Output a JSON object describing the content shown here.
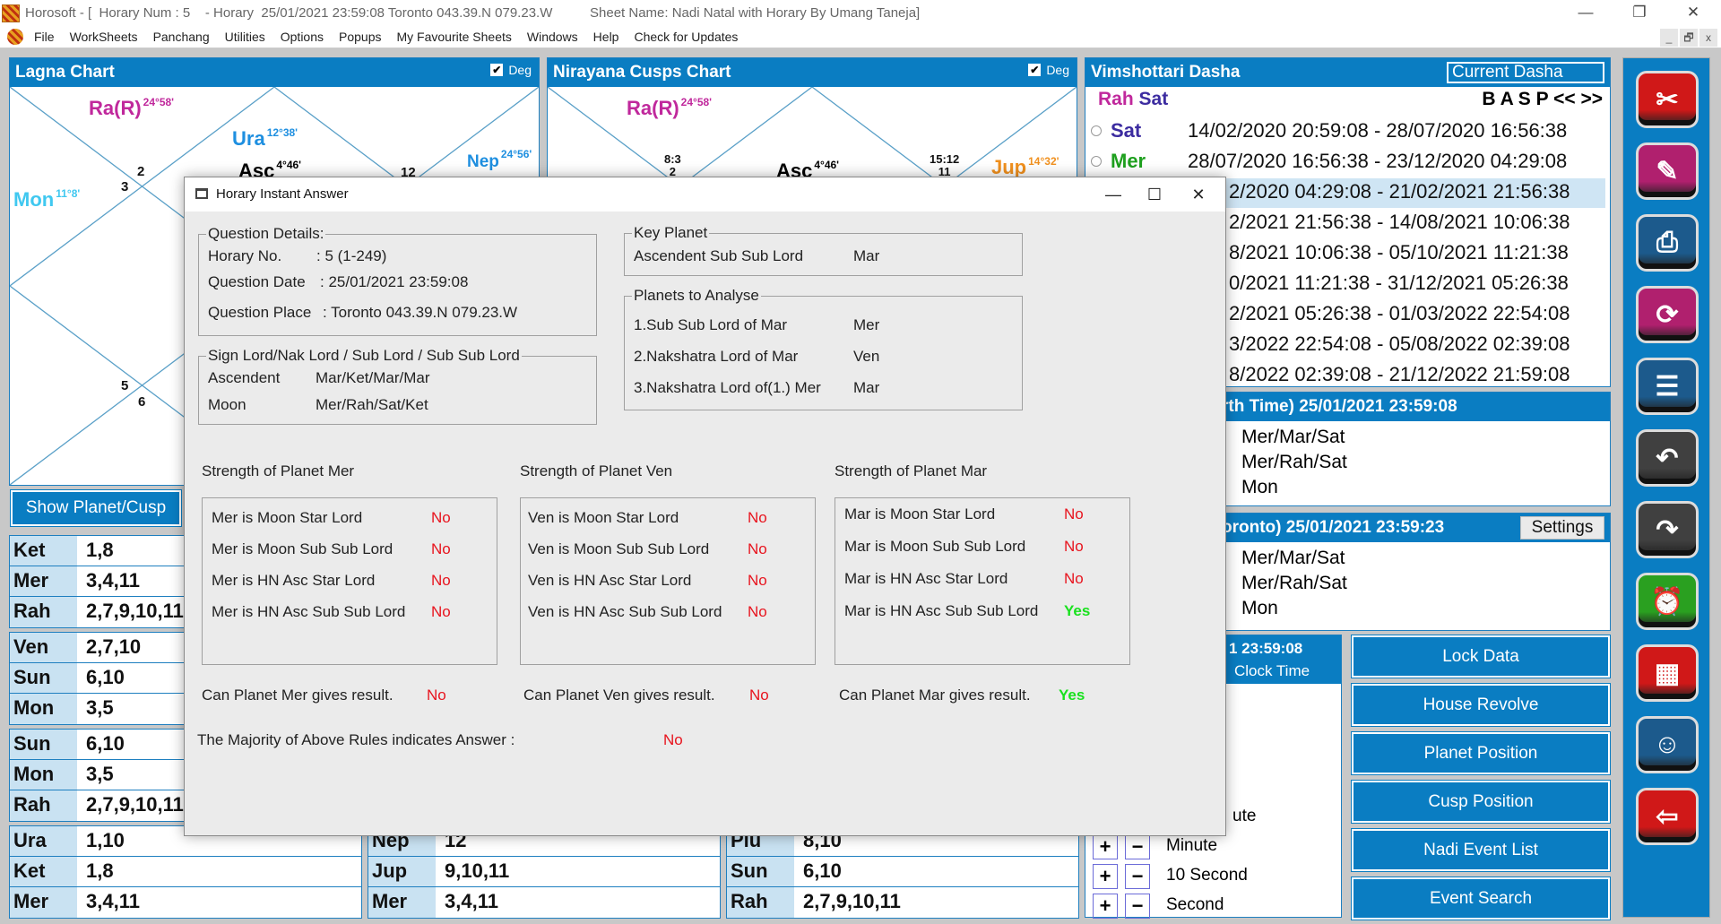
{
  "window": {
    "title": "Horosoft - [  Horary Num : 5    - Horary  25/01/2021 23:59:08 Toronto 043.39.N 079.23.W",
    "sheet_name": "Sheet Name: Nadi Natal with Horary By Umang Taneja]",
    "controls": {
      "minimize": "—",
      "restore": "❐",
      "close": "✕"
    }
  },
  "menubar": {
    "items": [
      "File",
      "WorkSheets",
      "Panchang",
      "Utilities",
      "Options",
      "Popups",
      "My Favourite Sheets",
      "Windows",
      "Help",
      "Check for Updates"
    ],
    "mdi_controls": [
      "_",
      "🗗",
      "x"
    ]
  },
  "lagna_chart": {
    "title": "Lagna Chart",
    "deg_label": "Deg",
    "deg_checked": true,
    "planets": [
      {
        "name": "Ra(R)",
        "deg": "24°58'",
        "color": "#c0289c"
      },
      {
        "name": "Ura",
        "deg": "12°38'",
        "color": "#1e8fe0"
      },
      {
        "name": "Asc",
        "deg": "4°46'",
        "color": "#111111"
      },
      {
        "name": "Nep",
        "deg": "24°56'",
        "color": "#1e8fe0"
      },
      {
        "name": "Mon",
        "deg": "11°8'",
        "color": "#40c8f0"
      }
    ],
    "house_numbers": [
      "2",
      "3",
      "12",
      "5",
      "6"
    ]
  },
  "cusps_chart": {
    "title": "Nirayana Cusps Chart",
    "deg_label": "Deg",
    "deg_checked": true,
    "planets": [
      {
        "name": "Ra(R)",
        "deg": "24°58'",
        "color": "#c0289c"
      },
      {
        "name": "Asc",
        "deg": "4°46'",
        "color": "#111111"
      },
      {
        "name": "Jup",
        "deg": "14°32'",
        "color": "#f0901e"
      }
    ],
    "cusp_labels": [
      {
        "deg": "8:3",
        "house": "2"
      },
      {
        "deg": "15:12",
        "house": "11"
      }
    ]
  },
  "show_planet_button": "Show Planet/Cusp",
  "left_tables": [
    [
      [
        "Ket",
        "1,8"
      ],
      [
        "Mer",
        "3,4,11"
      ],
      [
        "Rah",
        "2,7,9,10,11"
      ]
    ],
    [
      [
        "Ven",
        "2,7,10"
      ],
      [
        "Sun",
        "6,10"
      ],
      [
        "Mon",
        "3,5"
      ]
    ],
    [
      [
        "Sun",
        "6,10"
      ],
      [
        "Mon",
        "3,5"
      ],
      [
        "Rah",
        "2,7,9,10,11"
      ]
    ],
    [
      [
        "Ura",
        "1,10"
      ],
      [
        "Ket",
        "1,8"
      ],
      [
        "Mer",
        "3,4,11"
      ]
    ]
  ],
  "bottom_tables": [
    [
      [
        "Nep",
        "12"
      ],
      [
        "Jup",
        "9,10,11"
      ],
      [
        "Mer",
        "3,4,11"
      ]
    ],
    [
      [
        "Plu",
        "8,10"
      ],
      [
        "Sun",
        "6,10"
      ],
      [
        "Rah",
        "2,7,9,10,11"
      ]
    ]
  ],
  "dasha": {
    "title": "Vimshottari Dasha",
    "current_button": "Current Dasha",
    "lords": [
      {
        "name": "Rah",
        "color": "#c0289c"
      },
      {
        "name": "Sat",
        "color": "#3c2ca0"
      }
    ],
    "nav": "B A S P << >>",
    "rows": [
      {
        "planet": "Sat",
        "color": "#3c2ca0",
        "range": "14/02/2020 20:59:08 - 28/07/2020 16:56:38",
        "selected": false
      },
      {
        "planet": "Mer",
        "color": "#1ea01e",
        "range": "28/07/2020 16:56:38 - 23/12/2020 04:29:08",
        "selected": false
      },
      {
        "planet": "",
        "color": "#111111",
        "range": "2/2020 04:29:08 - 21/02/2021 21:56:38",
        "selected": true
      },
      {
        "planet": "",
        "color": "#111111",
        "range": "2/2021 21:56:38 - 14/08/2021 10:06:38",
        "selected": false
      },
      {
        "planet": "",
        "color": "#111111",
        "range": "8/2021 10:06:38 - 05/10/2021 11:21:38",
        "selected": false
      },
      {
        "planet": "",
        "color": "#111111",
        "range": "0/2021 11:21:38 - 31/12/2021 05:26:38",
        "selected": false
      },
      {
        "planet": "",
        "color": "#111111",
        "range": "2/2021 05:26:38 - 01/03/2022 22:54:08",
        "selected": false
      },
      {
        "planet": "",
        "color": "#111111",
        "range": "3/2022 22:54:08 - 05/08/2022 02:39:08",
        "selected": false
      },
      {
        "planet": "",
        "color": "#111111",
        "range": "8/2022 02:39:08 - 21/12/2022 21:59:08",
        "selected": false
      }
    ]
  },
  "birth_time": {
    "header": "rth Time) 25/01/2021 23:59:08",
    "lines": [
      "Mer/Mar/Sat",
      "Mer/Rah/Sat",
      "Mon"
    ]
  },
  "toronto_time": {
    "header": "oronto) 25/01/2021 23:59:23",
    "settings_button": "Settings",
    "lines": [
      "Mer/Mar/Sat",
      "Mer/Rah/Sat",
      "Mon"
    ]
  },
  "clock": {
    "header": "1 23:59:08",
    "sub_header": "Clock Time",
    "partial_label": "ute",
    "steps": [
      {
        "plus": "+",
        "minus": "−",
        "label": "Minute"
      },
      {
        "plus": "+",
        "minus": "−",
        "label": "10 Second"
      },
      {
        "plus": "+",
        "minus": "−",
        "label": "Second"
      }
    ]
  },
  "action_buttons": [
    "Lock Data",
    "House Revolve",
    "Planet Position",
    "Cusp Position",
    "Nadi Event List",
    "Event Search"
  ],
  "toolbar": [
    {
      "icon": "tools-icon",
      "glyph": "✂",
      "color": "#d01818"
    },
    {
      "icon": "edit-icon",
      "glyph": "✎",
      "color": "#b0206e"
    },
    {
      "icon": "print-icon",
      "glyph": "⎙",
      "color": "#1c5a8c"
    },
    {
      "icon": "cloud-sync-icon",
      "glyph": "⟳",
      "color": "#b0206e"
    },
    {
      "icon": "document-click-icon",
      "glyph": "☰",
      "color": "#1c5a8c"
    },
    {
      "icon": "back-arrow-icon",
      "glyph": "↶",
      "color": "#404040"
    },
    {
      "icon": "forward-arrow-icon",
      "glyph": "↷",
      "color": "#404040"
    },
    {
      "icon": "alarm-clock-icon",
      "glyph": "⏰",
      "color": "#2aa020"
    },
    {
      "icon": "calendar-icon",
      "glyph": "▦",
      "color": "#d01818"
    },
    {
      "icon": "group-icon",
      "glyph": "☺",
      "color": "#1c5a8c"
    },
    {
      "icon": "exit-icon",
      "glyph": "⇦",
      "color": "#d01818"
    }
  ],
  "dialog": {
    "title": "Horary Instant Answer",
    "question_details": {
      "legend": "Question Details:",
      "horary_no_label": "Horary No.",
      "horary_no_value": ": 5 (1-249)",
      "date_label": "Question Date",
      "date_value": ": 25/01/2021 23:59:08",
      "place_label": "Question Place",
      "place_value": ": Toronto 043.39.N 079.23.W"
    },
    "sign_lords": {
      "legend": "Sign Lord/Nak Lord / Sub Lord / Sub Sub Lord",
      "rows": [
        {
          "label": "Ascendent",
          "value": "Mar/Ket/Mar/Mar"
        },
        {
          "label": "Moon",
          "value": "Mer/Rah/Sat/Ket"
        }
      ]
    },
    "key_planet": {
      "legend": "Key Planet",
      "label": "Ascendent Sub Sub Lord",
      "value": "Mar"
    },
    "planets_to_analyse": {
      "legend": "Planets to Analyse",
      "rows": [
        {
          "label": "1.Sub Sub Lord of Mar",
          "value": "Mer"
        },
        {
          "label": "2.Nakshatra Lord of Mar",
          "value": "Ven"
        },
        {
          "label": "3.Nakshatra Lord of(1.) Mer",
          "value": "Mar"
        }
      ]
    },
    "strengths": [
      {
        "title": "Strength of Planet Mer",
        "rows": [
          {
            "label": "Mer is Moon Star Lord",
            "value": "No"
          },
          {
            "label": "Mer is Moon Sub Sub Lord",
            "value": "No"
          },
          {
            "label": "Mer is HN Asc Star Lord",
            "value": "No"
          },
          {
            "label": "Mer is HN Asc Sub Sub Lord",
            "value": "No"
          }
        ],
        "result_label": "Can Planet Mer gives result.",
        "result_value": "No"
      },
      {
        "title": "Strength of Planet Ven",
        "rows": [
          {
            "label": "Ven is Moon Star Lord",
            "value": "No"
          },
          {
            "label": "Ven is Moon Sub Sub Lord",
            "value": "No"
          },
          {
            "label": "Ven is HN Asc Star Lord",
            "value": "No"
          },
          {
            "label": "Ven is HN Asc Sub Sub Lord",
            "value": "No"
          }
        ],
        "result_label": "Can Planet Ven gives result.",
        "result_value": "No"
      },
      {
        "title": "Strength of Planet Mar",
        "rows": [
          {
            "label": "Mar is Moon Star Lord",
            "value": "No"
          },
          {
            "label": "Mar is Moon Sub Sub Lord",
            "value": "No"
          },
          {
            "label": "Mar is HN Asc Star Lord",
            "value": "No"
          },
          {
            "label": "Mar is HN Asc Sub Sub Lord",
            "value": "Yes"
          }
        ],
        "result_label": "Can Planet Mar gives result.",
        "result_value": "Yes"
      }
    ],
    "majority_label": "The Majority of Above Rules indicates Answer :",
    "majority_value": "No"
  }
}
